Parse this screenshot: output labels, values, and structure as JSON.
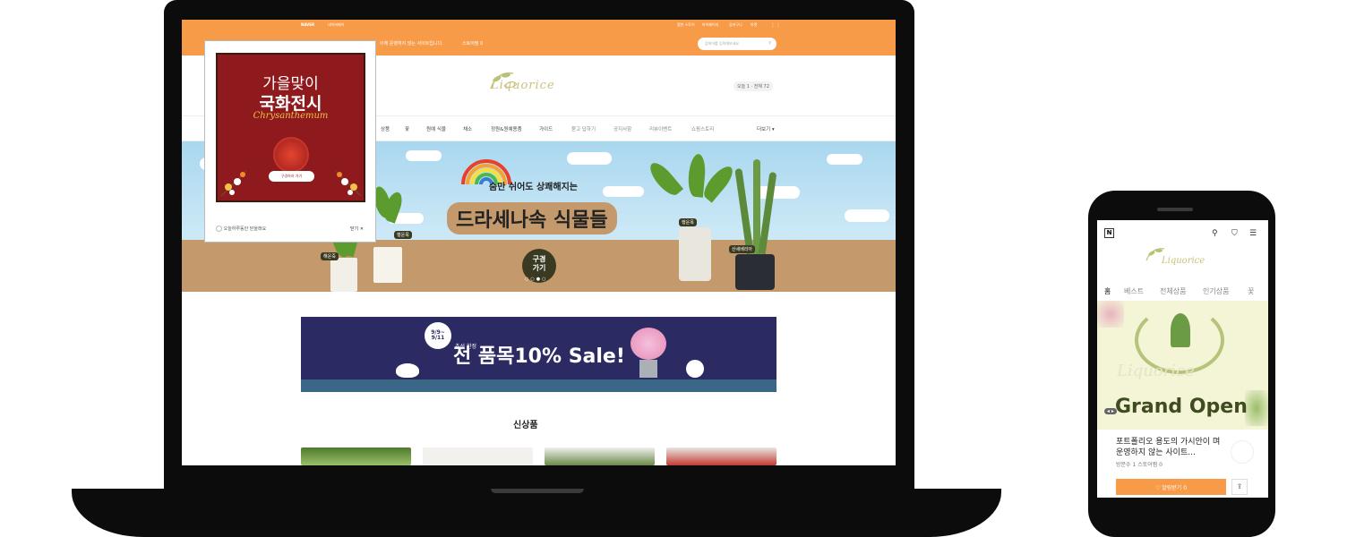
{
  "laptop": {
    "topbar": {
      "naver": "NAVER",
      "pay": "네이버페이",
      "store_links": [
        "찜한 스토어",
        "마이페이지",
        "장바구니",
        "마켓"
      ],
      "notice": "이에 운영하지 않는 사이트입니다.",
      "store_count": "스토어찜 0",
      "search_placeholder": "검색어를 입력해보세요"
    },
    "header": {
      "logo": "Liquorice",
      "visits": "오늘 1 · 전체 72"
    },
    "nav": [
      "상품",
      "꽃",
      "원예 식물",
      "채소",
      "정원&원예용품",
      "가이드",
      "묻고 답하기",
      "공지사항",
      "리뷰이벤트",
      "쇼핑스토리",
      "더보기"
    ],
    "hero": {
      "subtitle": "숨만 쉬어도 상쾌해지는",
      "title": "드라세나속 식물들",
      "button": "구경\n가기",
      "plant_tags": [
        "해운죽",
        "행운목",
        "행운목",
        "산세베리아"
      ]
    },
    "sale": {
      "date": "9/9~\n9/11",
      "small": "추석 한정",
      "big": "전 품목10% Sale!"
    },
    "section_title": "신상품",
    "popup": {
      "line1": "가을맞이",
      "line2": "국화전시",
      "english": "Chrysanthemum",
      "button": "구경하러 가기",
      "dismiss": "오늘하루동안 닫을래요",
      "close": "닫기 ✕"
    }
  },
  "phone": {
    "brand_icon": "N",
    "logo": "Liquorice",
    "tabs": [
      "홈",
      "베스트",
      "전체상품",
      "인기상품",
      "꽃"
    ],
    "hero_logo": "Liquorice",
    "hero_title": "Grand Open",
    "card_title": "포트폴리오 용도의 가시안이 며 운영하지 않는 사이트...",
    "card_sub": "방문수 1  스토어찜 0",
    "follow_button": "♡ 알림받기 0"
  },
  "colors": {
    "accent": "#f79b48",
    "sale_bg": "#2b2a63",
    "popup_bg": "#8e1a1d"
  }
}
